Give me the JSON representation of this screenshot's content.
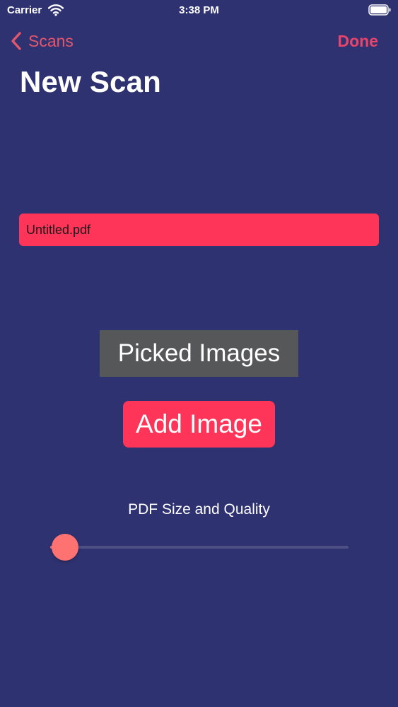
{
  "status_bar": {
    "carrier": "Carrier",
    "time": "3:38 PM",
    "wifi_icon": "wifi-icon",
    "battery_icon": "battery-full-icon"
  },
  "nav": {
    "back_label": "Scans",
    "back_icon": "chevron-left-icon",
    "done_label": "Done"
  },
  "page": {
    "title": "New Scan"
  },
  "filename_field": {
    "value": "Untitled.pdf"
  },
  "picked_images": {
    "label": "Picked Images"
  },
  "add_image": {
    "label": "Add Image"
  },
  "quality_slider": {
    "label": "PDF Size and Quality",
    "value_fraction": 0.05
  },
  "colors": {
    "background": "#2f3270",
    "accent": "#ff3459",
    "nav_tint": "#e9446a",
    "slider_accent": "#ff7272",
    "picked_images_bg": "#555759"
  }
}
